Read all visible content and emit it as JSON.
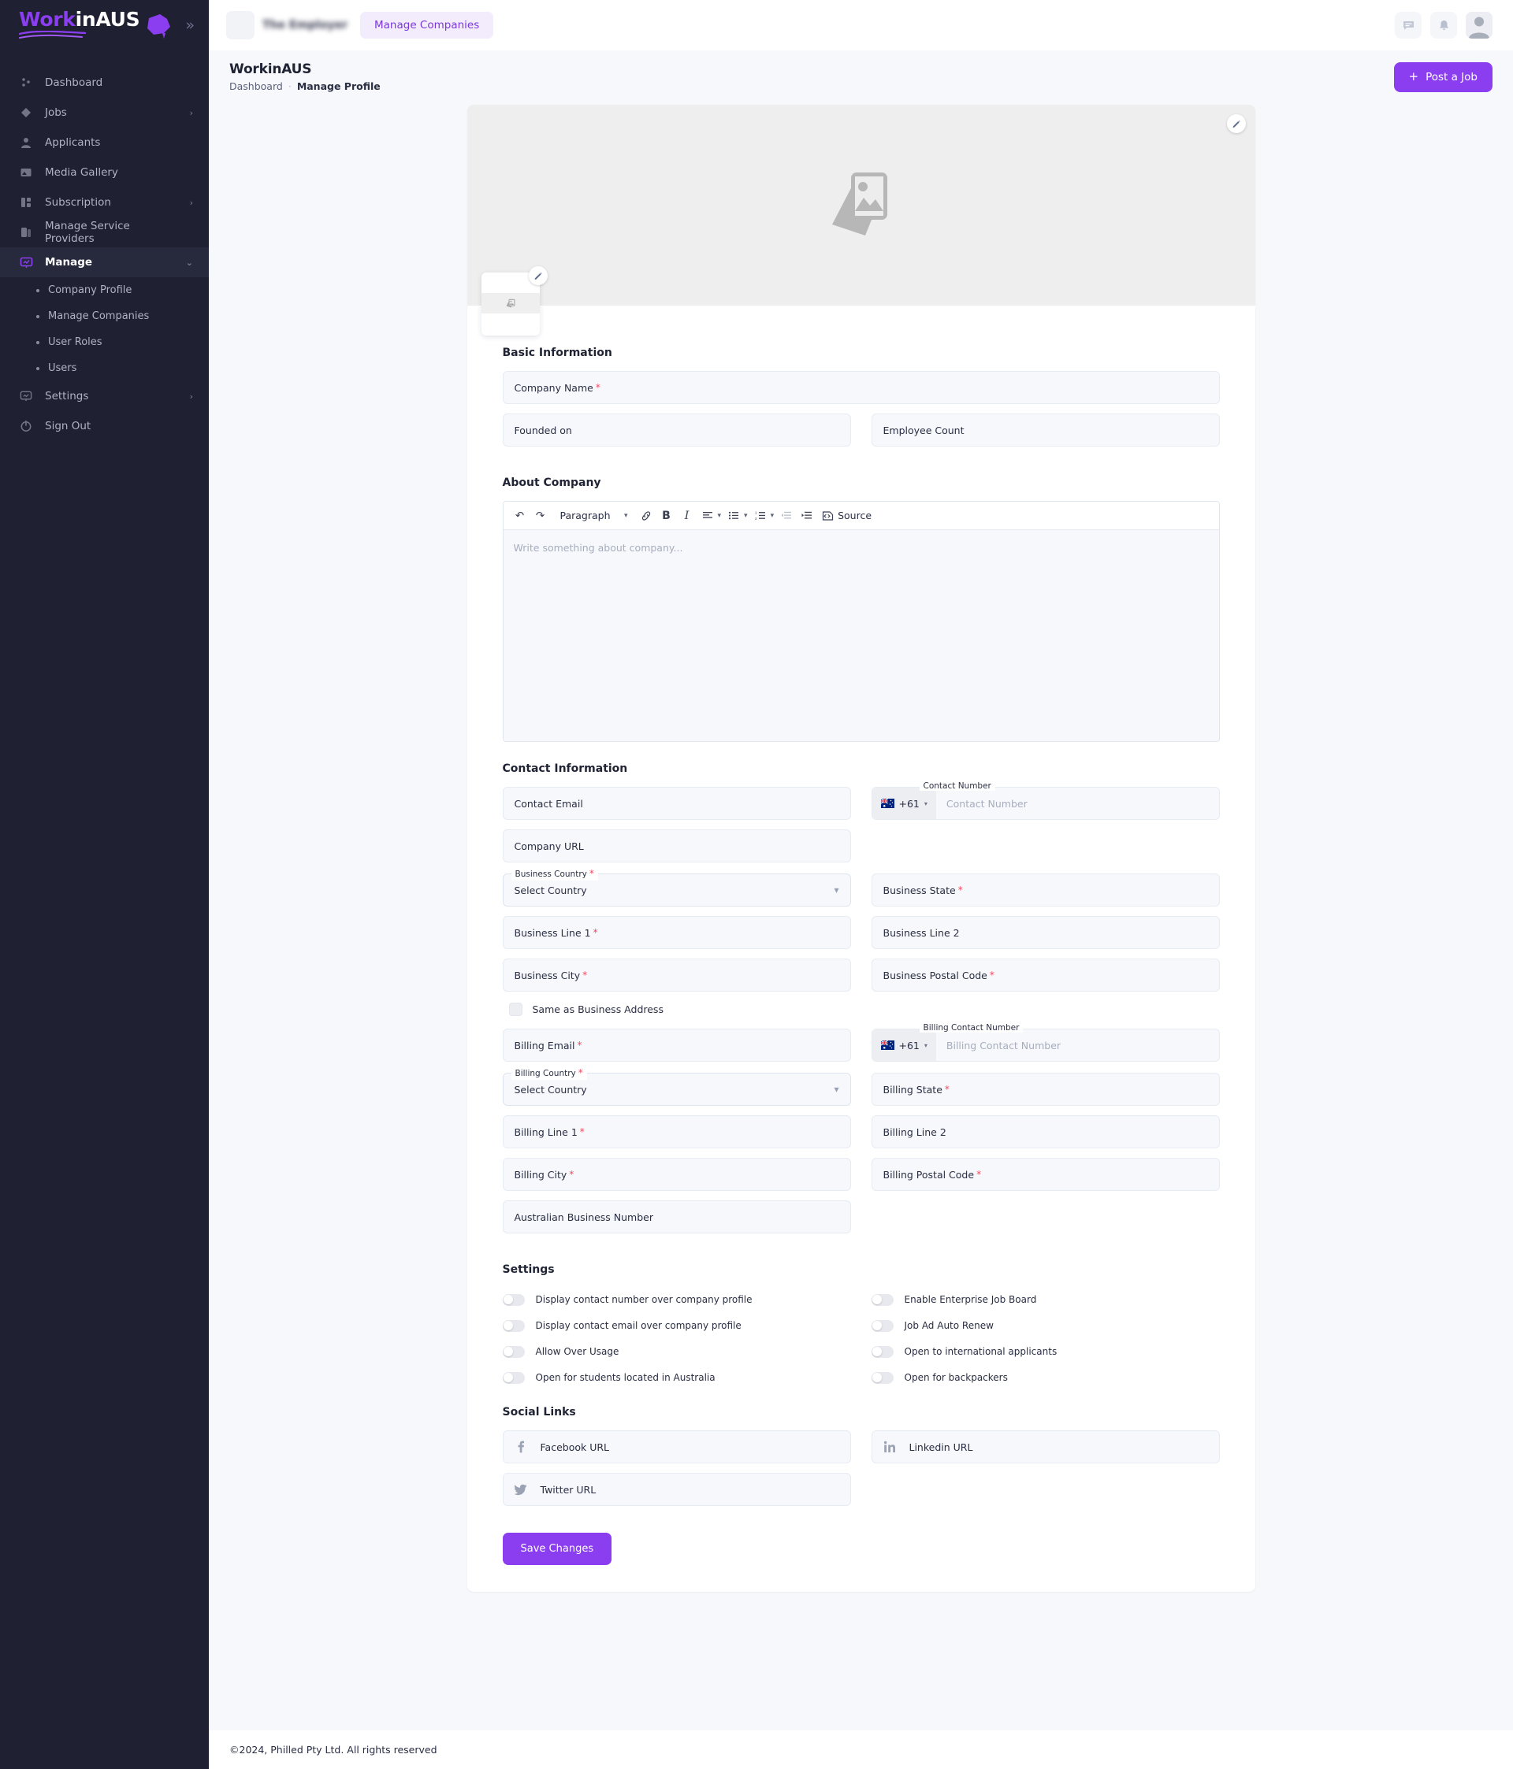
{
  "sidebar": {
    "logo": {
      "part1": "Work",
      "part2": "in",
      "part3": "AUS"
    },
    "collapse_label": "»",
    "items": [
      {
        "label": "Dashboard",
        "icon": "dashboard-icon",
        "chevron": ""
      },
      {
        "label": "Jobs",
        "icon": "jobs-icon",
        "chevron": "›"
      },
      {
        "label": "Applicants",
        "icon": "applicants-icon",
        "chevron": ""
      },
      {
        "label": "Media Gallery",
        "icon": "media-gallery-icon",
        "chevron": ""
      },
      {
        "label": "Subscription",
        "icon": "subscription-icon",
        "chevron": "›"
      },
      {
        "label": "Manage Service Providers",
        "icon": "service-providers-icon",
        "chevron": ""
      },
      {
        "label": "Manage",
        "icon": "manage-icon",
        "chevron": "⌄",
        "active": true
      }
    ],
    "sub_items": [
      {
        "label": "Company Profile"
      },
      {
        "label": "Manage Companies"
      },
      {
        "label": "User Roles"
      },
      {
        "label": "Users"
      }
    ],
    "tail_items": [
      {
        "label": "Settings",
        "icon": "settings-icon",
        "chevron": "›"
      },
      {
        "label": "Sign Out",
        "icon": "sign-out-icon",
        "chevron": ""
      }
    ]
  },
  "topbar": {
    "company_name": "The Employer",
    "manage_companies_label": "Manage Companies"
  },
  "pagehead": {
    "title": "WorkinAUS",
    "crumb_root": "Dashboard",
    "crumb_sep": "·",
    "crumb_current": "Manage Profile",
    "post_job_label": "Post a Job",
    "post_job_plus": "+"
  },
  "basic": {
    "section_title": "Basic Information",
    "company_name": {
      "label": "Company Name",
      "required": "*",
      "value": ""
    },
    "founded_on": {
      "label": "Founded on",
      "value": ""
    },
    "employee_count": {
      "label": "Employee Count",
      "value": ""
    }
  },
  "about": {
    "section_title": "About Company",
    "toolbar": {
      "undo": "↶",
      "redo": "↷",
      "paragraph": "Paragraph",
      "link": "link-icon",
      "bold": "B",
      "italic": "I",
      "align": "align-icon",
      "bullet_list": "bullet-list-icon",
      "numbered_list": "numbered-list-icon",
      "outdent": "outdent-icon",
      "indent": "indent-icon",
      "source_label": "Source"
    },
    "placeholder": "Write something about company..."
  },
  "contact": {
    "section_title": "Contact Information",
    "contact_email": {
      "label": "Contact Email"
    },
    "contact_number": {
      "float_label": "Contact Number",
      "country_code": "+61",
      "placeholder": "Contact Number"
    },
    "company_url": {
      "label": "Company URL"
    },
    "business_country": {
      "float_label": "Business Country",
      "required": "*",
      "value": "Select Country"
    },
    "business_state": {
      "label": "Business State",
      "required": "*"
    },
    "business_line1": {
      "label": "Business Line 1",
      "required": "*"
    },
    "business_line2": {
      "label": "Business Line 2"
    },
    "business_city": {
      "label": "Business City",
      "required": "*"
    },
    "business_postal": {
      "label": "Business Postal Code",
      "required": "*"
    },
    "same_as_business": "Same as Business Address",
    "billing_email": {
      "label": "Billing Email",
      "required": "*"
    },
    "billing_number": {
      "float_label": "Billing Contact Number",
      "country_code": "+61",
      "placeholder": "Billing Contact Number"
    },
    "billing_country": {
      "float_label": "Billing Country",
      "required": "*",
      "value": "Select Country"
    },
    "billing_state": {
      "label": "Billing State",
      "required": "*"
    },
    "billing_line1": {
      "label": "Billing Line 1",
      "required": "*"
    },
    "billing_line2": {
      "label": "Billing Line 2"
    },
    "billing_city": {
      "label": "Billing City",
      "required": "*"
    },
    "billing_postal": {
      "label": "Billing Postal Code",
      "required": "*"
    },
    "abn": {
      "label": "Australian Business Number"
    }
  },
  "settings": {
    "section_title": "Settings",
    "left": [
      {
        "label": "Display contact number over company profile",
        "on": false
      },
      {
        "label": "Display contact email over company profile",
        "on": false
      },
      {
        "label": "Allow Over Usage",
        "on": false
      },
      {
        "label": "Open for students located in Australia",
        "on": false
      }
    ],
    "right": [
      {
        "label": "Enable Enterprise Job Board",
        "on": false
      },
      {
        "label": "Job Ad Auto Renew",
        "on": false
      },
      {
        "label": "Open to international applicants",
        "on": false
      },
      {
        "label": "Open for backpackers",
        "on": false
      }
    ]
  },
  "social": {
    "section_title": "Social Links",
    "facebook": {
      "label": "Facebook URL",
      "icon": "facebook-icon"
    },
    "linkedin": {
      "label": "Linkedin URL",
      "icon": "linkedin-icon"
    },
    "twitter": {
      "label": "Twitter URL",
      "icon": "twitter-icon"
    }
  },
  "save_label": "Save Changes",
  "footer": "©2024, Philled Pty Ltd. All rights reserved",
  "colors": {
    "accent": "#8b3ef0",
    "sidebar_bg": "#1f2031",
    "required": "#f4475f",
    "page_bg": "#f6f8fb"
  }
}
